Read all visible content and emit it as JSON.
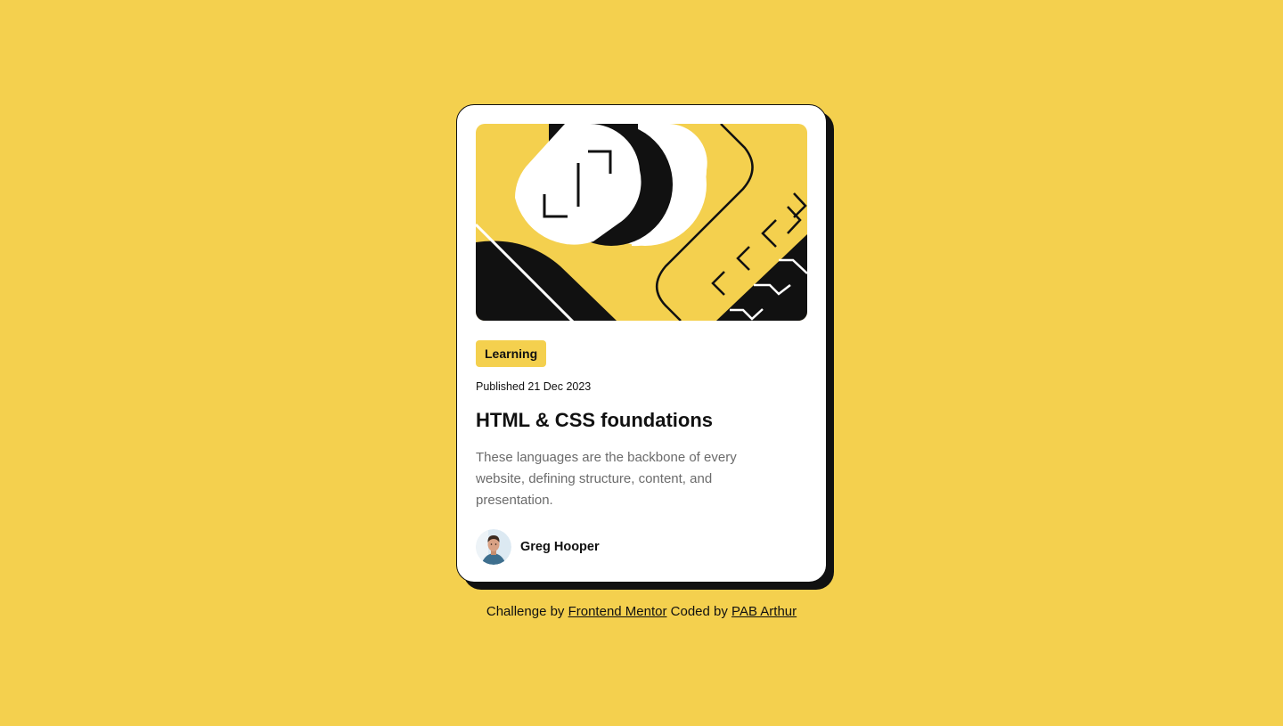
{
  "card": {
    "tag": "Learning",
    "published": "Published 21 Dec 2023",
    "title": "HTML & CSS foundations",
    "description": "These languages are the backbone of every website, defining structure, content, and presentation.",
    "author": {
      "name": "Greg Hooper"
    }
  },
  "attribution": {
    "challenge_prefix": "Challenge by",
    "challenge_link": "Frontend Mentor",
    "coded_prefix": "Coded by",
    "coded_link": "PAB Arthur"
  },
  "colors": {
    "background": "#F4D04E",
    "card": "#FFFFFF",
    "ink": "#111111",
    "muted": "#6B6B6B"
  },
  "icons": {
    "hero": "abstract-illustration",
    "avatar": "author-photo"
  }
}
